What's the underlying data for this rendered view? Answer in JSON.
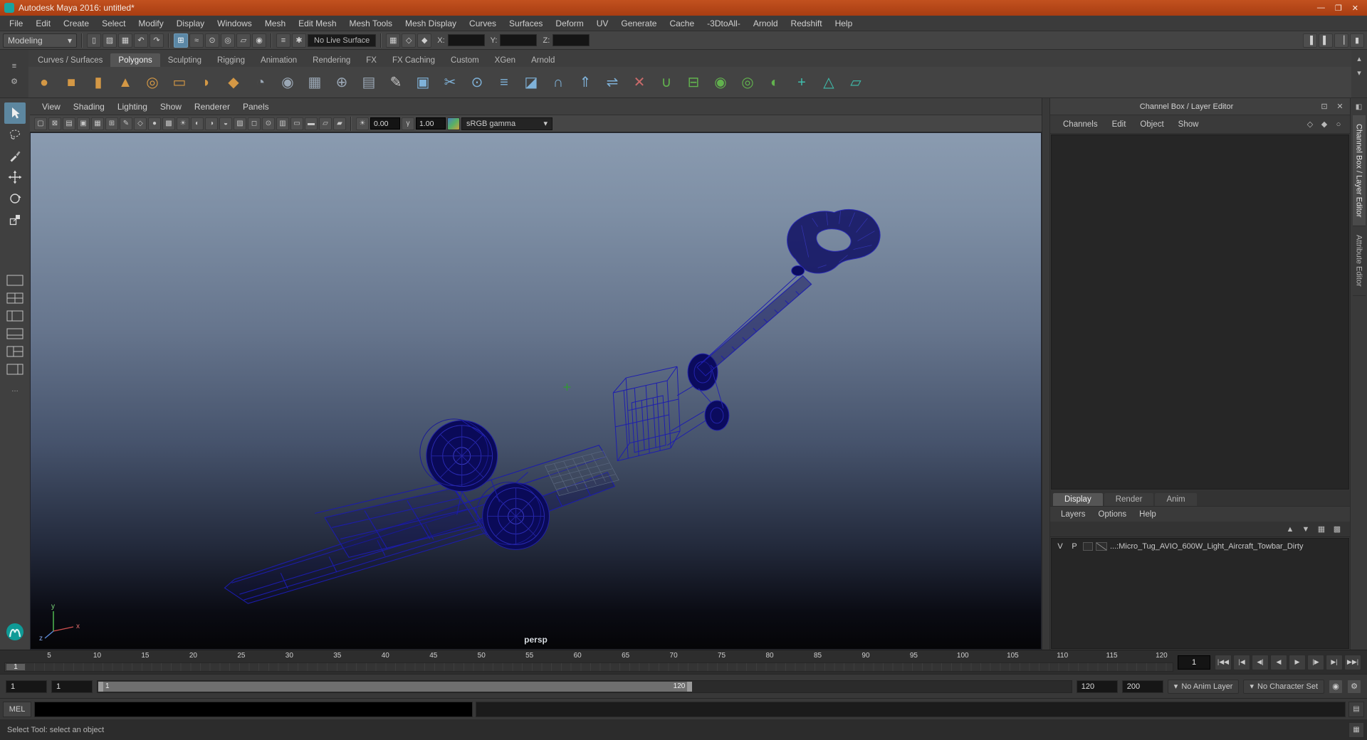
{
  "ui": {
    "caret_down": "▾",
    "caret_up": "▴"
  },
  "colors": {
    "titlebar_orange": "#b8481c",
    "wireframe_blue": "#1c1caa",
    "viewport_top": "#8a9bb0",
    "viewport_bottom": "#050507",
    "active_tool_blue": "#5d87a0"
  },
  "window": {
    "title": "Autodesk Maya 2016: untitled*",
    "minimize": "—",
    "maximize": "❐",
    "close": "✕"
  },
  "menubar": [
    "File",
    "Edit",
    "Create",
    "Select",
    "Modify",
    "Display",
    "Windows",
    "Mesh",
    "Edit Mesh",
    "Mesh Tools",
    "Mesh Display",
    "Curves",
    "Surfaces",
    "Deform",
    "UV",
    "Generate",
    "Cache",
    "-3DtoAll-",
    "Arnold",
    "Redshift",
    "Help"
  ],
  "statusline": {
    "menuset": "Modeling",
    "file_icons": [
      {
        "name": "new-scene-icon",
        "glyph": "▯"
      },
      {
        "name": "open-scene-icon",
        "glyph": "▨"
      },
      {
        "name": "save-scene-icon",
        "glyph": "▦"
      }
    ],
    "undo_icons": [
      {
        "name": "undo-icon",
        "glyph": "↶"
      },
      {
        "name": "redo-icon",
        "glyph": "↷"
      }
    ],
    "snap_icons": [
      {
        "name": "snap-to-grids-icon",
        "glyph": "⊞",
        "active": true
      },
      {
        "name": "snap-to-curves-icon",
        "glyph": "≈"
      },
      {
        "name": "snap-to-points-icon",
        "glyph": "⊙"
      },
      {
        "name": "snap-to-projected-center-icon",
        "glyph": "◎"
      },
      {
        "name": "snap-to-view-planes-icon",
        "glyph": "▱"
      },
      {
        "name": "make-live-icon",
        "glyph": "◉"
      }
    ],
    "history_icons": [
      {
        "name": "inputs-to-selected-icon",
        "glyph": "≡"
      },
      {
        "name": "construction-history-icon",
        "glyph": "✱"
      }
    ],
    "live_surface": "No Live Surface",
    "display_icons": [
      {
        "name": "grid-options-icon",
        "glyph": "▦"
      },
      {
        "name": "selection-mask-icon",
        "glyph": "◇"
      },
      {
        "name": "highlight-selection-icon",
        "glyph": "◆"
      }
    ],
    "coords": {
      "x_label": "X:",
      "y_label": "Y:",
      "z_label": "Z:",
      "x_value": "",
      "y_value": "",
      "z_value": ""
    },
    "sidebar_icons": [
      {
        "name": "show-attribute-editor-icon",
        "glyph": "▐"
      },
      {
        "name": "show-tool-settings-icon",
        "glyph": "▌"
      },
      {
        "name": "show-channel-box-icon",
        "glyph": "▕"
      },
      {
        "name": "show-workspace-icon",
        "glyph": "▮"
      }
    ]
  },
  "shelf": {
    "menu_icons": [
      {
        "name": "shelf-menu-icon",
        "glyph": "≡"
      },
      {
        "name": "shelf-gear-icon",
        "glyph": "⚙"
      }
    ],
    "scroll_icons": [
      {
        "name": "shelf-scroll-up-icon",
        "glyph": "▴"
      },
      {
        "name": "shelf-overflow-icon",
        "glyph": "▾"
      }
    ],
    "tabs": [
      {
        "label": "Curves / Surfaces"
      },
      {
        "label": "Polygons",
        "active": true
      },
      {
        "label": "Sculpting"
      },
      {
        "label": "Rigging"
      },
      {
        "label": "Animation"
      },
      {
        "label": "Rendering"
      },
      {
        "label": "FX"
      },
      {
        "label": "FX Caching"
      },
      {
        "label": "Custom"
      },
      {
        "label": "XGen"
      },
      {
        "label": "Arnold"
      }
    ],
    "items": [
      {
        "name": "polygon-sphere-icon",
        "glyph": "●",
        "color": "#d49845"
      },
      {
        "name": "polygon-cube-icon",
        "glyph": "■",
        "color": "#d49845"
      },
      {
        "name": "polygon-cylinder-icon",
        "glyph": "▮",
        "color": "#d49845"
      },
      {
        "name": "polygon-cone-icon",
        "glyph": "▲",
        "color": "#d49845"
      },
      {
        "name": "polygon-torus-icon",
        "glyph": "◎",
        "color": "#d49845"
      },
      {
        "name": "polygon-plane-icon",
        "glyph": "▭",
        "color": "#d49845"
      },
      {
        "name": "polygon-disc-icon",
        "glyph": "◗",
        "color": "#d49845"
      },
      {
        "name": "polygon-platonic-icon",
        "glyph": "◆",
        "color": "#d49845"
      },
      {
        "name": "sculpt-sphere-icon",
        "glyph": "◔",
        "color": "#9aa7b5"
      },
      {
        "name": "smooth-mesh-icon",
        "glyph": "◉",
        "color": "#9aa7b5"
      },
      {
        "name": "make-grid-icon",
        "glyph": "▦",
        "color": "#9aa7b5"
      },
      {
        "name": "wireframe-sphere-icon",
        "glyph": "⊕",
        "color": "#9aa7b5"
      },
      {
        "name": "lattice-icon",
        "glyph": "▤",
        "color": "#9aa7b5"
      },
      {
        "name": "create-polygon-tool-icon",
        "glyph": "✎",
        "color": "#c8c8c8"
      },
      {
        "name": "quad-draw-tool-icon",
        "glyph": "▣",
        "color": "#7fb2d9"
      },
      {
        "name": "multi-cut-tool-icon",
        "glyph": "✂",
        "color": "#7fb2d9"
      },
      {
        "name": "target-weld-tool-icon",
        "glyph": "⊙",
        "color": "#7fb2d9"
      },
      {
        "name": "insert-edge-loop-icon",
        "glyph": "≡",
        "color": "#7fb2d9"
      },
      {
        "name": "bevel-icon",
        "glyph": "◪",
        "color": "#7fb2d9"
      },
      {
        "name": "bridge-icon",
        "glyph": "∩",
        "color": "#7fb2d9"
      },
      {
        "name": "extrude-icon",
        "glyph": "⇑",
        "color": "#7fb2d9"
      },
      {
        "name": "mirror-icon",
        "glyph": "⇌",
        "color": "#7fb2d9"
      },
      {
        "name": "delete-edge-icon",
        "glyph": "✕",
        "color": "#c96a6a"
      },
      {
        "name": "combine-icon",
        "glyph": "∪",
        "color": "#62b24e"
      },
      {
        "name": "separate-icon",
        "glyph": "⊟",
        "color": "#62b24e"
      },
      {
        "name": "boolean-union-icon",
        "glyph": "◉",
        "color": "#62b24e"
      },
      {
        "name": "boolean-difference-icon",
        "glyph": "◎",
        "color": "#62b24e"
      },
      {
        "name": "boolean-intersection-icon",
        "glyph": "◐",
        "color": "#62b24e"
      },
      {
        "name": "smooth-icon",
        "glyph": "+",
        "color": "#3fbfae"
      },
      {
        "name": "triangulate-icon",
        "glyph": "△",
        "color": "#3fbfae"
      },
      {
        "name": "quadrangulate-icon",
        "glyph": "▱",
        "color": "#3fbfae"
      }
    ]
  },
  "toolbox": {
    "tools": [
      "select-tool",
      "lasso-tool",
      "paint-selection-tool",
      "move-tool",
      "rotate-tool",
      "scale-tool"
    ],
    "layouts": [
      "layout-single-pane",
      "layout-four-pane",
      "layout-persp-outliner",
      "layout-persp-graph",
      "layout-hypershade",
      "layout-two-pane"
    ],
    "more": "…"
  },
  "viewport": {
    "panel_menus": [
      "View",
      "Shading",
      "Lighting",
      "Show",
      "Renderer",
      "Panels"
    ],
    "toolbar_icons": [
      {
        "name": "select-camera-icon",
        "glyph": "▢"
      },
      {
        "name": "lock-camera-icon",
        "glyph": "⊠"
      },
      {
        "name": "camera-attributes-icon",
        "glyph": "▤"
      },
      {
        "name": "bookmarks-icon",
        "glyph": "▣"
      },
      {
        "name": "image-plane-icon",
        "glyph": "▦"
      },
      {
        "name": "pan-zoom-2d-icon",
        "glyph": "⊞"
      },
      {
        "name": "grease-pencil-icon",
        "glyph": "✎"
      },
      {
        "name": "wireframe-display-icon",
        "glyph": "◇"
      },
      {
        "name": "smooth-shade-icon",
        "glyph": "●"
      },
      {
        "name": "textured-icon",
        "glyph": "▩"
      },
      {
        "name": "use-all-lights-icon",
        "glyph": "☀"
      },
      {
        "name": "shadows-icon",
        "glyph": "◐"
      },
      {
        "name": "ambient-occlusion-icon",
        "glyph": "◑"
      },
      {
        "name": "motion-blur-icon",
        "glyph": "◒"
      },
      {
        "name": "multisample-aa-icon",
        "glyph": "▨"
      },
      {
        "name": "xray-icon",
        "glyph": "◻"
      },
      {
        "name": "isolate-select-icon",
        "glyph": "⊙"
      },
      {
        "name": "field-chart-icon",
        "glyph": "▥"
      },
      {
        "name": "resolution-gate-icon",
        "glyph": "▭"
      },
      {
        "name": "gate-mask-icon",
        "glyph": "▬"
      },
      {
        "name": "safe-action-icon",
        "glyph": "▱"
      },
      {
        "name": "safe-title-icon",
        "glyph": "▰"
      }
    ],
    "exposure_icon": "☀",
    "exposure_value": "0.00",
    "gamma_icon": "γ",
    "gamma_value": "1.00",
    "view_transform": "sRGB gamma",
    "camera_label": "persp",
    "axis": {
      "x": "x",
      "y": "y",
      "z": "z"
    }
  },
  "channel_box": {
    "header": "Channel Box / Layer Editor",
    "header_icons": [
      {
        "name": "dock-icon",
        "glyph": "⊡"
      },
      {
        "name": "close-icon",
        "glyph": "✕"
      }
    ],
    "menus": [
      "Channels",
      "Edit",
      "Object",
      "Show"
    ],
    "mini_icons": [
      {
        "name": "channel-sliders-icon",
        "glyph": "◇"
      },
      {
        "name": "channel-manipulator-icon",
        "glyph": "◆"
      },
      {
        "name": "channel-speed-icon",
        "glyph": "○"
      }
    ]
  },
  "layer_editor": {
    "tabs": [
      {
        "label": "Display",
        "active": true
      },
      {
        "label": "Render"
      },
      {
        "label": "Anim"
      }
    ],
    "menus": [
      "Layers",
      "Options",
      "Help"
    ],
    "toolbar_icons": [
      {
        "name": "move-layer-up-icon",
        "glyph": "▲"
      },
      {
        "name": "move-layer-down-icon",
        "glyph": "▼"
      },
      {
        "name": "new-empty-layer-icon",
        "glyph": "▦"
      },
      {
        "name": "new-layer-from-selected-icon",
        "glyph": "▩"
      }
    ],
    "layer_row": {
      "visibility": "V",
      "playback": "P",
      "name": "...:Micro_Tug_AVIO_600W_Light_Aircraft_Towbar_Dirty"
    }
  },
  "right_strip": {
    "icon": {
      "name": "panel-dock-icon",
      "glyph": "◧"
    },
    "tabs": [
      {
        "label": "Channel Box / Layer Editor",
        "active": true
      },
      {
        "label": "Attribute Editor"
      }
    ]
  },
  "timeline": {
    "ticks": [
      "5",
      "10",
      "15",
      "20",
      "25",
      "30",
      "35",
      "40",
      "45",
      "50",
      "55",
      "60",
      "65",
      "70",
      "75",
      "80",
      "85",
      "90",
      "95",
      "100",
      "105",
      "110",
      "115",
      "120"
    ],
    "current_frame": "1",
    "current_time": "1",
    "playback": [
      {
        "name": "go-to-start-button",
        "glyph": "|◀◀"
      },
      {
        "name": "step-back-frame-button",
        "glyph": "|◀"
      },
      {
        "name": "step-back-key-button",
        "glyph": "◀|"
      },
      {
        "name": "play-backwards-button",
        "glyph": "◀"
      },
      {
        "name": "play-forwards-button",
        "glyph": "▶"
      },
      {
        "name": "step-forward-key-button",
        "glyph": "|▶"
      },
      {
        "name": "step-forward-frame-button",
        "glyph": "▶|"
      },
      {
        "name": "go-to-end-button",
        "glyph": "▶▶|"
      }
    ]
  },
  "range_slider": {
    "anim_start": "1",
    "playback_start": "1",
    "bar_start": "1",
    "bar_end": "120",
    "playback_end": "120",
    "anim_end": "200",
    "anim_layer": "No Anim Layer",
    "character_set": "No Character Set",
    "icons": [
      {
        "name": "auto-keyframe-icon",
        "glyph": "◉"
      },
      {
        "name": "anim-preferences-icon",
        "glyph": "⚙"
      }
    ]
  },
  "command_line": {
    "label": "MEL",
    "input_value": "",
    "script_editor_icon": "▤",
    "corner_icon": "▦"
  },
  "help_line": {
    "text": "Select Tool: select an object"
  }
}
